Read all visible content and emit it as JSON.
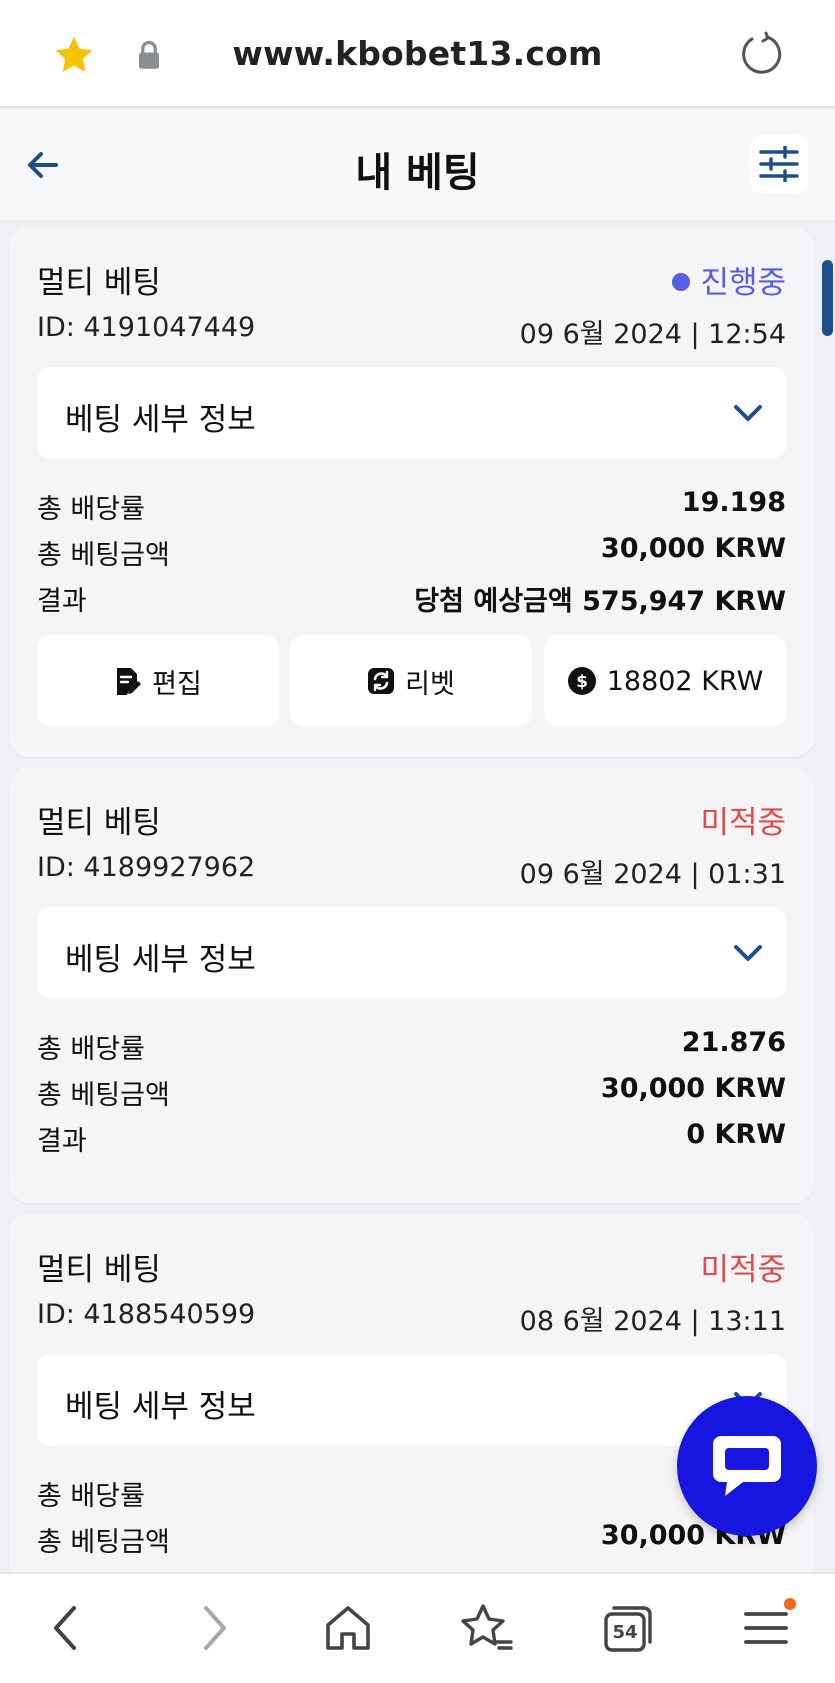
{
  "browser": {
    "url": "www.kbobet13.com",
    "tabs_count": "54"
  },
  "header": {
    "title": "내 베팅"
  },
  "labels": {
    "detail": "베팅 세부 정보",
    "total_odds": "총 배당률",
    "total_stake": "총 베팅금액",
    "result": "결과"
  },
  "bets": [
    {
      "type": "멀티 베팅",
      "status": "진행중",
      "id": "ID: 4191047449",
      "date": "09 6월 2024 | 12:54",
      "odds": "19.198",
      "stake": "30,000 KRW",
      "result": "당첨 예상금액 575,947 KRW",
      "actions": {
        "edit": "편집",
        "rebet": "리벳",
        "cashout": "18802 KRW"
      }
    },
    {
      "type": "멀티 베팅",
      "status": "미적중",
      "id": "ID: 4189927962",
      "date": "09 6월 2024 | 01:31",
      "odds": "21.876",
      "stake": "30,000 KRW",
      "result": "0 KRW"
    },
    {
      "type": "멀티 베팅",
      "status": "미적중",
      "id": "ID: 4188540599",
      "date": "08 6월 2024 | 13:11",
      "odds": "",
      "stake": "30,000 KRW",
      "result": ""
    }
  ],
  "colors": {
    "active": "#5b5ce6",
    "lost": "#e04b4b",
    "chat": "#1616e0",
    "accent": "#1e4f8c"
  },
  "icons": [
    "star-icon",
    "lock-icon",
    "reload-icon",
    "back-arrow-icon",
    "filter-icon",
    "chevron-down-icon",
    "edit-doc-icon",
    "rebet-icon",
    "dollar-icon",
    "chat-icon",
    "nav-back-icon",
    "nav-forward-icon",
    "home-icon",
    "bookmarks-icon",
    "tabs-icon",
    "menu-icon"
  ]
}
